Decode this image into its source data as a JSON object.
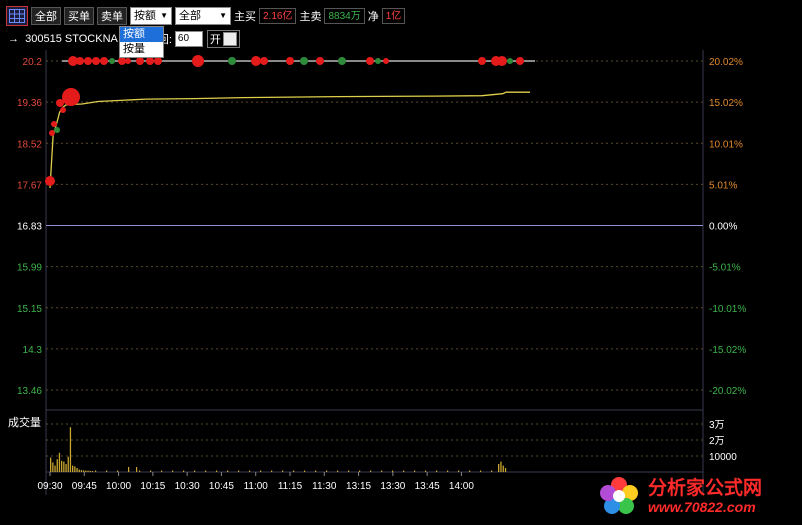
{
  "toolbar": {
    "all_label": "全部",
    "buy_label": "买单",
    "sell_label": "卖单",
    "mode_select": "按额",
    "filter_select": "全部",
    "main_buy_label": "主买",
    "main_buy_value": "2.16亿",
    "main_sell_label": "主卖",
    "main_sell_value": "8834万",
    "net_label": "净",
    "net_value": "1亿"
  },
  "mode_dropdown": {
    "options": [
      "按额",
      "按量"
    ],
    "highlighted": "按额"
  },
  "subbar": {
    "stock_text": "→  300515 STOCKNA",
    "period_label": "回:",
    "period_value": "60",
    "open_label": "开"
  },
  "chart_data": {
    "type": "line",
    "time_ticks": [
      "09:30",
      "09:45",
      "10:00",
      "10:15",
      "10:30",
      "10:45",
      "11:00",
      "11:15",
      "11:30",
      "13:15",
      "13:30",
      "13:45",
      "14:00"
    ],
    "price_ticks": [
      "20.2",
      "19.36",
      "18.52",
      "17.67",
      "16.83",
      "15.99",
      "15.15",
      "14.3",
      "13.46"
    ],
    "pct_ticks": [
      "20.02%",
      "15.02%",
      "10.01%",
      "5.01%",
      "0.00%",
      "-5.01%",
      "-10.01%",
      "-15.02%",
      "-20.02%"
    ],
    "prev_close": 16.83,
    "ylim": [
      13.46,
      20.2
    ],
    "price_series": {
      "time_min": [
        0,
        2,
        4,
        6,
        8,
        10,
        15,
        20,
        30,
        60,
        90,
        120,
        150,
        180,
        240,
        270,
        283,
        285,
        300
      ],
      "values": [
        17.6,
        18.7,
        18.9,
        19.15,
        19.25,
        19.3,
        19.31,
        19.32,
        19.37,
        19.42,
        19.43,
        19.45,
        19.46,
        19.47,
        19.48,
        19.49,
        19.53,
        19.56,
        19.56
      ]
    },
    "volume_label": "成交量",
    "volume_ticks": [
      "3万",
      "2万",
      "10000"
    ],
    "volume_ylim": [
      0,
      30000
    ]
  },
  "logo": {
    "title": "分析家公式网",
    "url": "www.70822.com"
  }
}
